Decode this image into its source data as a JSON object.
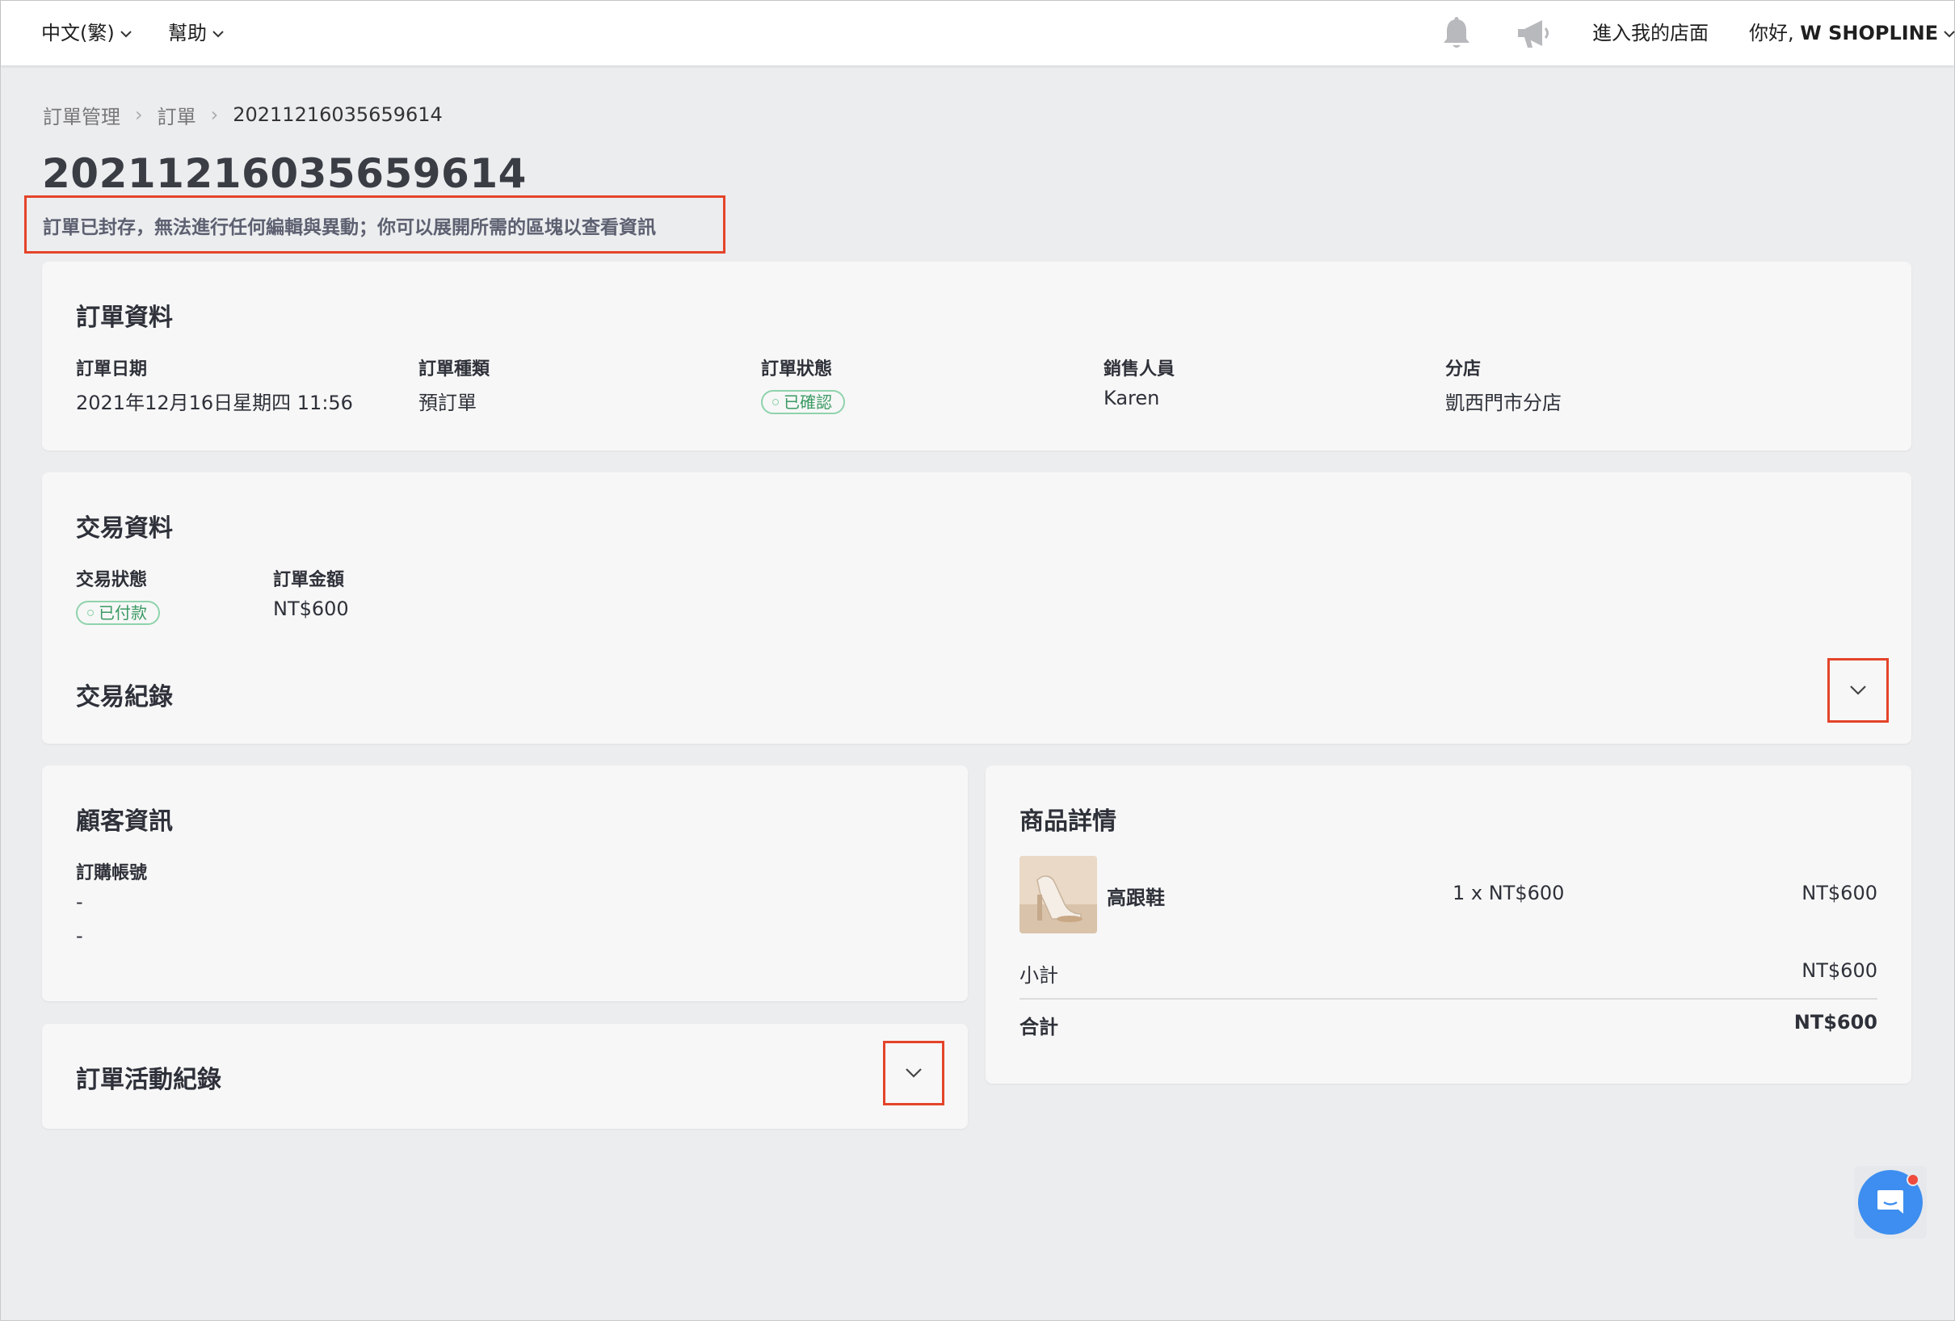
{
  "topbar": {
    "language": "中文(繁)",
    "help": "幫助",
    "store_link": "進入我的店面",
    "greeting_prefix": "你好, ",
    "user_name": "W SHOPLINE"
  },
  "breadcrumb": [
    "訂單管理",
    "訂單",
    "20211216035659614"
  ],
  "page_title": "20211216035659614",
  "archived_notice": "訂單已封存，無法進行任何編輯與異動；你可以展開所需的區塊以查看資訊",
  "order_info": {
    "title": "訂單資料",
    "fields": [
      {
        "label": "訂單日期",
        "value": "2021年12月16日星期四 11:56"
      },
      {
        "label": "訂單種類",
        "value": "預訂單"
      },
      {
        "label": "訂單狀態",
        "badge": "已確認"
      },
      {
        "label": "銷售人員",
        "value": "Karen"
      },
      {
        "label": "分店",
        "value": "凱西門市分店"
      }
    ]
  },
  "transaction_info": {
    "title": "交易資料",
    "status_label": "交易狀態",
    "status_badge": "已付款",
    "amount_label": "訂單金額",
    "amount_value": "NT$600",
    "log_title": "交易紀錄"
  },
  "customer_info": {
    "title": "顧客資訊",
    "account_label": "訂購帳號",
    "line1": "-",
    "line2": "-"
  },
  "activity_log": {
    "title": "訂單活動紀錄"
  },
  "product_details": {
    "title": "商品詳情",
    "item": {
      "name": "高跟鞋",
      "qty_price": "1 x NT$600",
      "total": "NT$600"
    },
    "subtotal_label": "小計",
    "subtotal_value": "NT$600",
    "total_label": "合計",
    "total_value": "NT$600"
  },
  "colors": {
    "highlight_border": "#e4442a",
    "badge_green": "#3a9a63",
    "chat_blue": "#3d8ef0"
  }
}
